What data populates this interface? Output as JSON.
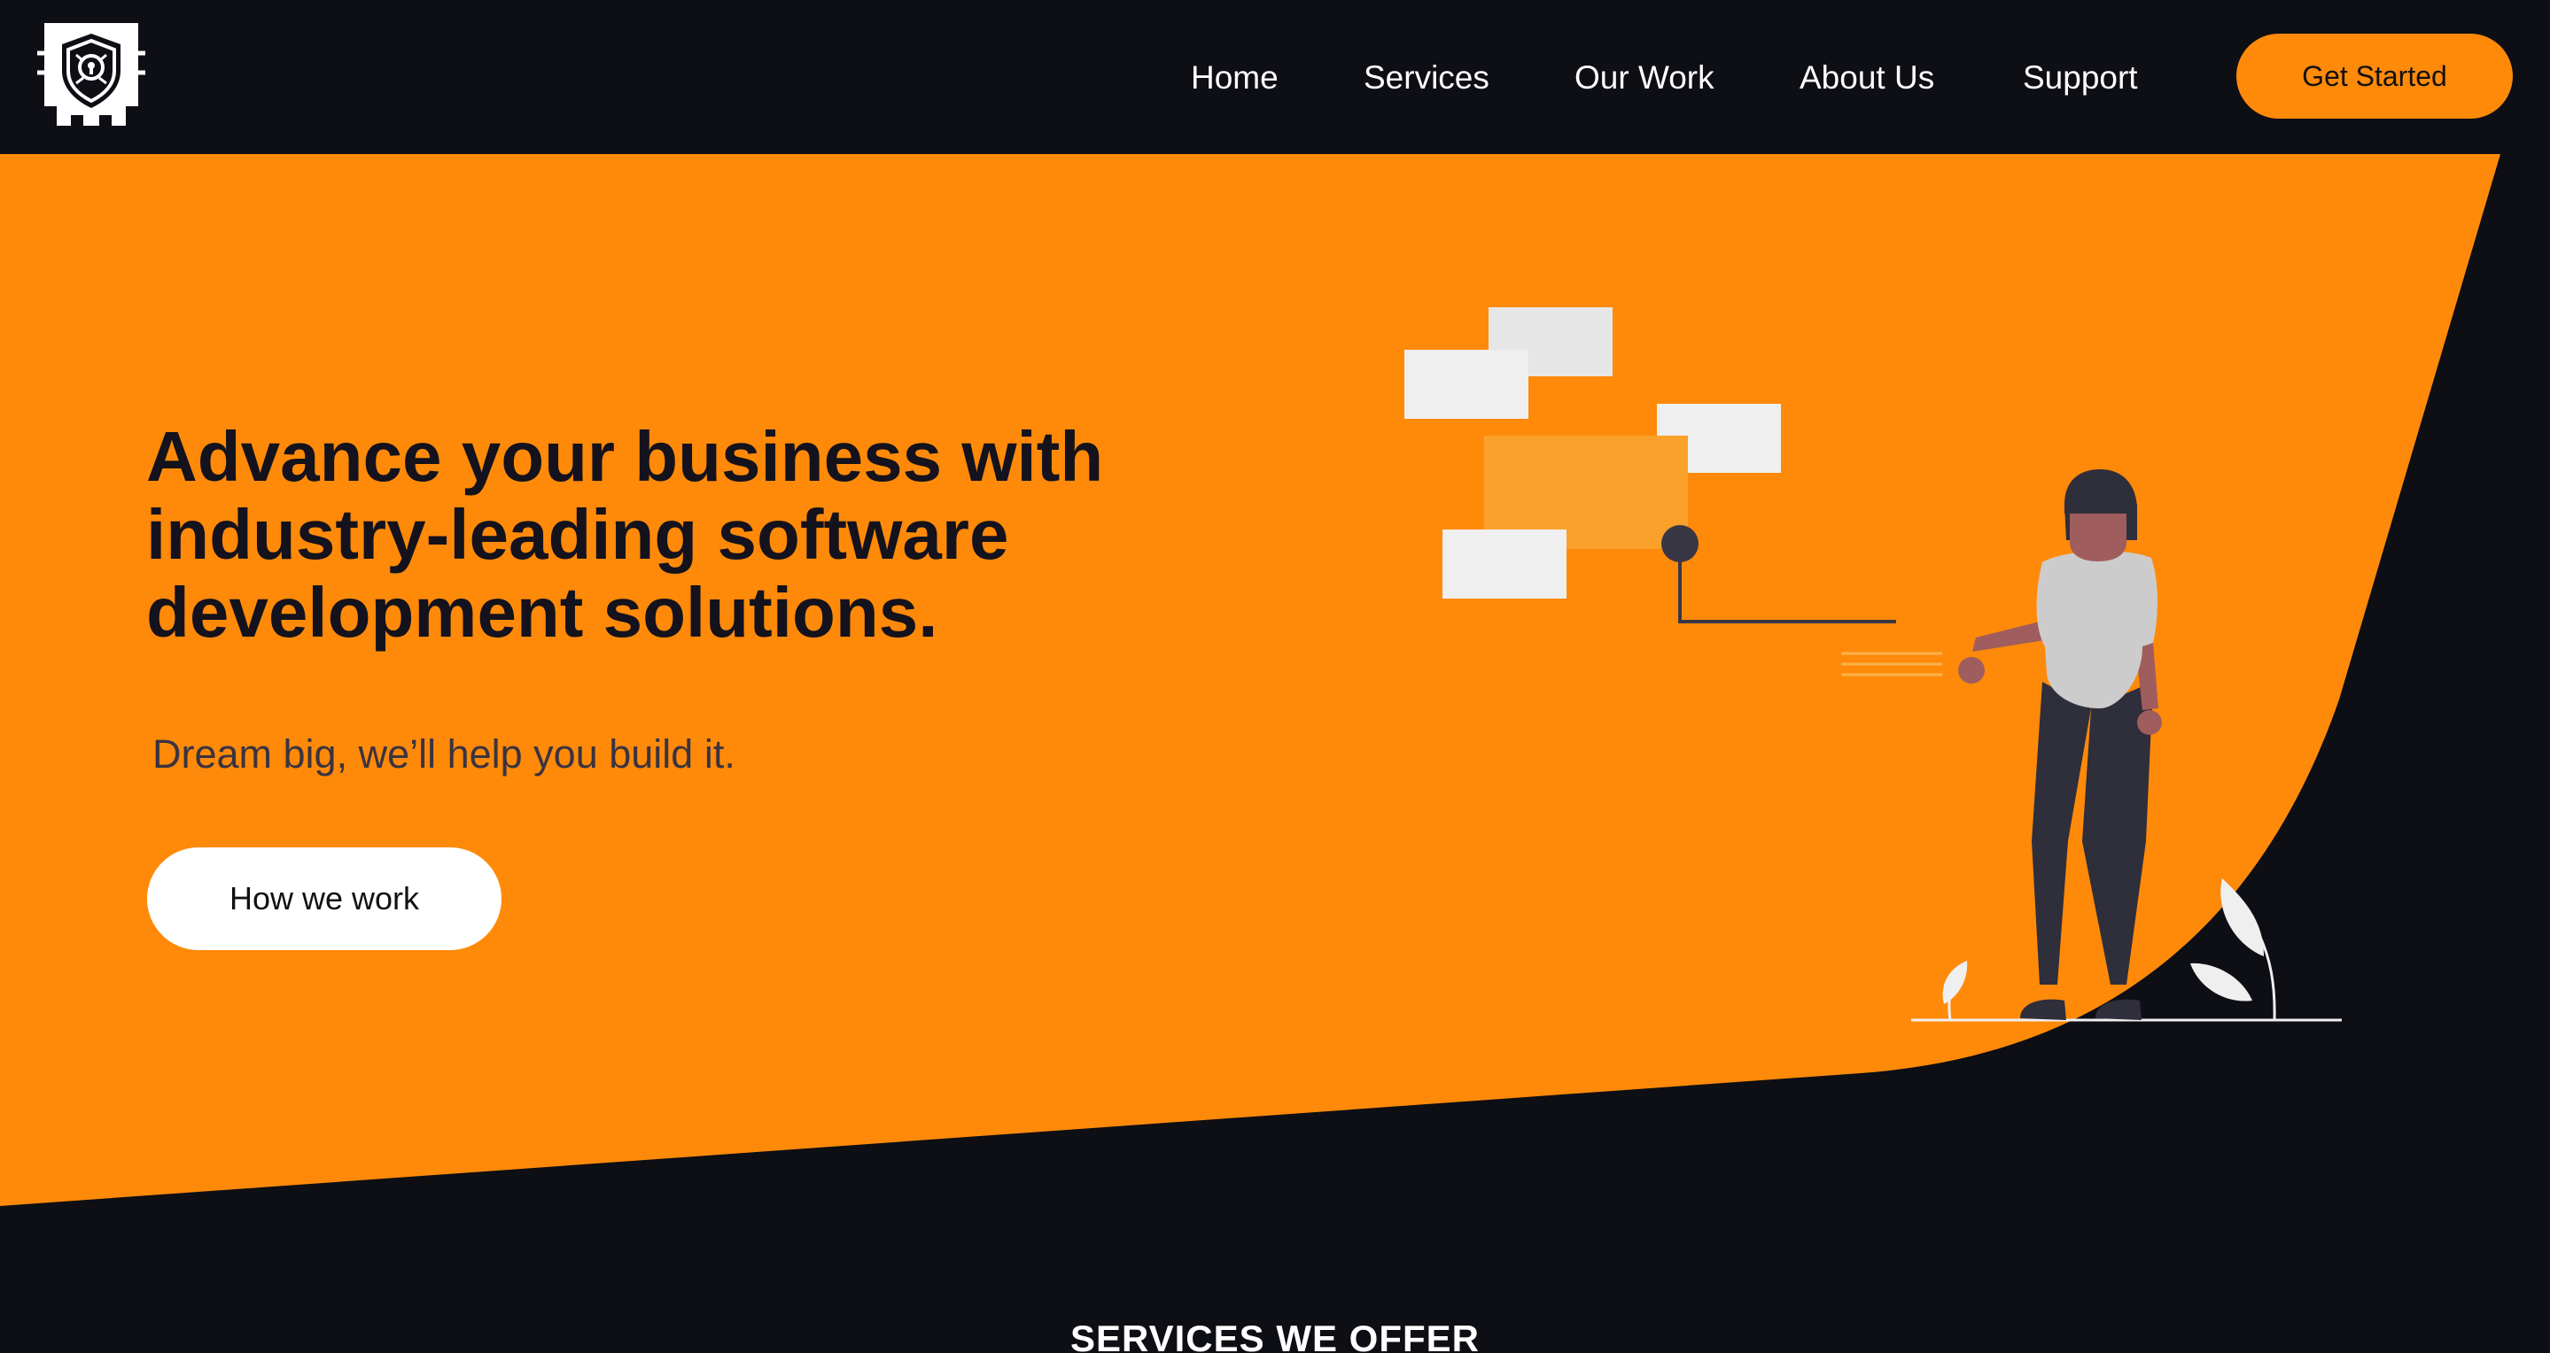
{
  "brand": {
    "accent": "#ff8a09",
    "dark": "#0e0e15",
    "logo_icon": "shield-circuit-icon"
  },
  "nav": {
    "items": [
      "Home",
      "Services",
      "Our Work",
      "About Us",
      "Support"
    ],
    "cta_label": "Get Started"
  },
  "hero": {
    "title_lines": [
      "Advance your business with",
      "industry-leading software",
      "development solutions."
    ],
    "subtitle": "Dream big, we’ll help you build it.",
    "button_label": "How we work",
    "illustration_icon": "presentation-woman-illustration"
  },
  "services": {
    "title": "SERVICES WE OFFER"
  }
}
